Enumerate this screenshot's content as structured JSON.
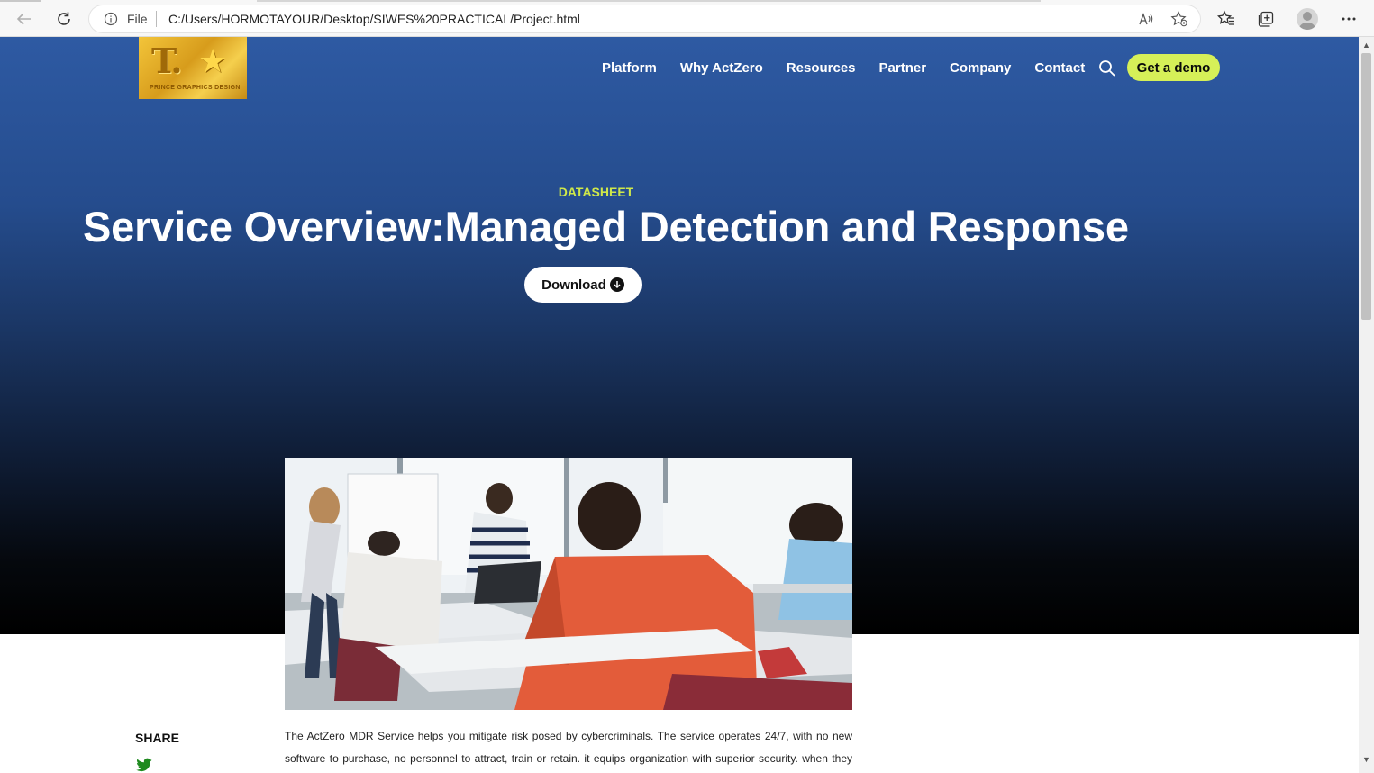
{
  "browser": {
    "file_label": "File",
    "url": "C:/Users/HORMOTAYOUR/Desktop/SIWES%20PRACTICAL/Project.html",
    "icons": [
      "back-arrow-icon",
      "reload-icon",
      "info-icon",
      "read-aloud-icon",
      "add-favorite-icon",
      "favorites-icon",
      "collections-icon",
      "profile-icon",
      "more-icon"
    ]
  },
  "logo": {
    "mark": "T.",
    "star": "★",
    "tagline": "PRINCE GRAPHICS DESIGN"
  },
  "nav": {
    "items": [
      "Platform",
      "Why ActZero",
      "Resources",
      "Partner",
      "Company",
      "Contact"
    ],
    "cta": "Get a demo"
  },
  "hero": {
    "eyebrow": "DATASHEET",
    "title": "Service Overview:Managed Detection and Response",
    "download_label": "Download"
  },
  "content": {
    "share_label": "SHARE",
    "body": "The ActZero MDR Service helps you mitigate risk posed by cybercriminals. The service operates 24/7, with no new software to purchase, no personnel to attract, train or retain. it equips organization with superior security. when they are"
  },
  "colors": {
    "hero_top": "#2e5aa3",
    "hero_bottom": "#000000",
    "accent": "#d6f058",
    "eyebrow": "#cfe84a",
    "twitter": "#1e8a1e"
  }
}
